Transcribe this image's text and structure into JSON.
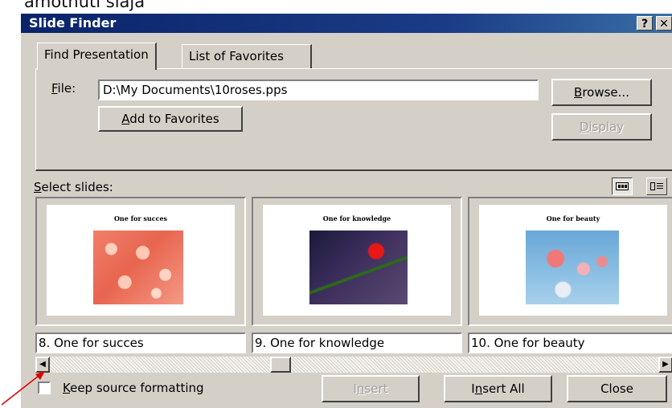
{
  "caption_fragment": "amotnuti slaja",
  "dialog": {
    "title": "Slide Finder",
    "help_button": "?",
    "close_x": "✕"
  },
  "tabs": [
    {
      "label": "Find Presentation",
      "active": true
    },
    {
      "label": "List of Favorites",
      "active": false
    }
  ],
  "file": {
    "label_mnemonic": "F",
    "label_rest": "ile:",
    "value": "D:\\My Documents\\10roses.pps"
  },
  "buttons": {
    "browse_mnemonic": "B",
    "browse_rest": "rowse...",
    "add_favorites_mnemonic": "A",
    "add_favorites_rest": "dd to Favorites",
    "display_mnemonic": "D",
    "display_rest": "isplay",
    "insert_pre": "I",
    "insert_mnemonic": "n",
    "insert_rest": "sert",
    "insert_all_pre": "I",
    "insert_all_mnemonic": "n",
    "insert_all_rest": "sert All",
    "close": "Close"
  },
  "select_slides": {
    "label_mnemonic": "S",
    "label_rest": "elect slides:"
  },
  "slides": [
    {
      "caption": "8. One for succes",
      "slide_title": "One for succes",
      "image": "pink-roses-photo"
    },
    {
      "caption": "9. One for knowledge",
      "slide_title": "One for knowledge",
      "image": "red-rose-photo"
    },
    {
      "caption": "10. One for beauty",
      "slide_title": "One for beauty",
      "image": "roses-sky-photo"
    }
  ],
  "keep_source": {
    "label_mnemonic": "K",
    "label_rest": "eep source formatting",
    "checked": false
  },
  "colors": {
    "title_bar": "#0a246a",
    "dialog_face": "#d4d0c8",
    "annotation_arrow": "#e00000"
  }
}
